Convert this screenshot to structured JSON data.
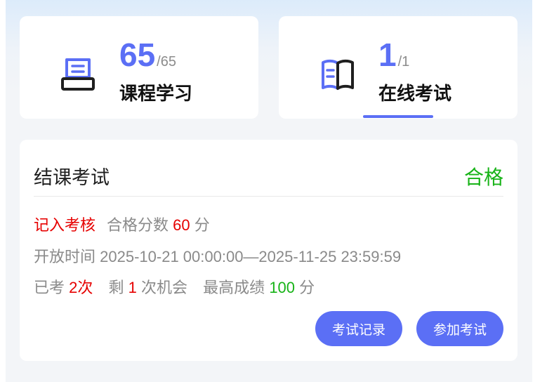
{
  "stats": {
    "course": {
      "done": "65",
      "total": "/65",
      "label": "课程学习",
      "icon": "course-book-stand-icon"
    },
    "exam": {
      "done": "1",
      "total": "/1",
      "label": "在线考试",
      "icon": "open-book-icon"
    }
  },
  "exam_card": {
    "title": "结课考试",
    "result": "合格",
    "assessment_tag": "记入考核",
    "pass_score_label": "合格分数",
    "pass_score": "60",
    "score_unit": "分",
    "open_time_label": "开放时间",
    "open_time": "2025-10-21 00:00:00—2025-11-25 23:59:59",
    "taken_label": "已考",
    "taken_value": "2次",
    "remaining_prefix": "剩",
    "remaining_count": "1",
    "remaining_suffix": "次机会",
    "best_score_label": "最高成绩",
    "best_score": "100",
    "buttons": {
      "records": "考试记录",
      "join": "参加考试"
    }
  },
  "colors": {
    "accent": "#5b6ff5",
    "pass_green": "#17b317",
    "highlight_red": "#e60000"
  },
  "active_tab": "exam"
}
